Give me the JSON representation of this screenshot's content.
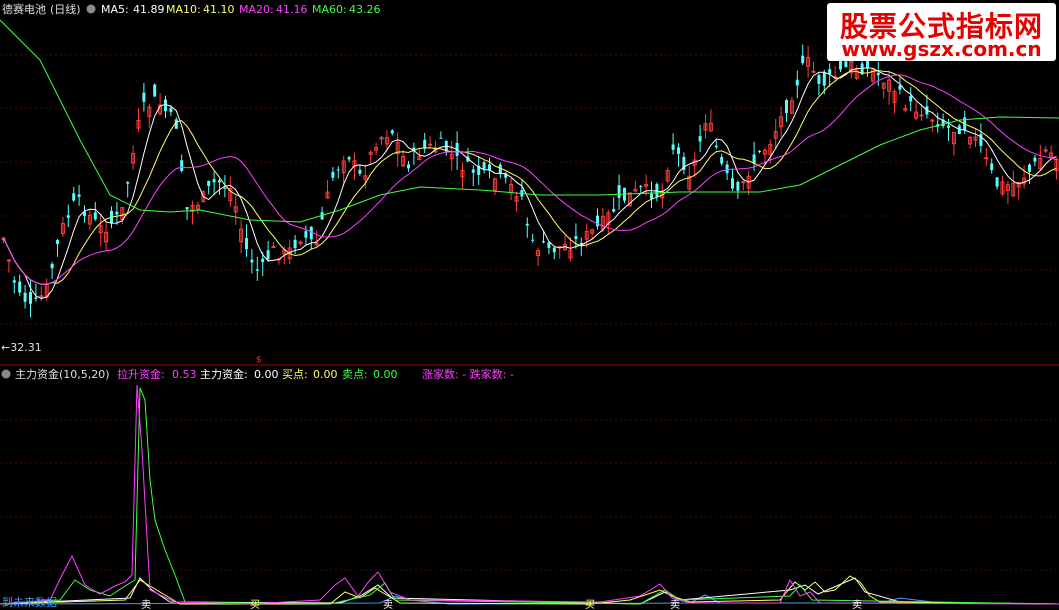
{
  "top_pane": {
    "stock_name": "德赛电池",
    "period": "(日线)",
    "ma": [
      {
        "label": "MA5:",
        "value": "41.89",
        "color": "#ffffff"
      },
      {
        "label": "MA10:",
        "value": "41.10",
        "color": "#ffff66"
      },
      {
        "label": "MA20:",
        "value": "41.16",
        "color": "#ff40ff"
      },
      {
        "label": "MA60:",
        "value": "43.26",
        "color": "#40ff40"
      }
    ],
    "low_marker": "←32.31"
  },
  "bottom_pane": {
    "indicator_name": "主力资金(10,5,20)",
    "fields": [
      {
        "label": "拉升资金:",
        "value": "0.53",
        "color": "#ff40ff"
      },
      {
        "label": "主力资金:",
        "value": "0.00",
        "color": "#ffffff"
      },
      {
        "label": "买点:",
        "value": "0.00",
        "color": "#ffff66"
      },
      {
        "label": "卖点:",
        "value": "0.00",
        "color": "#40ff40"
      }
    ],
    "rise_fall": {
      "label": "涨家数: - 跌家数: -",
      "color": "#ff40ff"
    },
    "footer_text": "到未来数据",
    "sell_marks": [
      "卖",
      "卖",
      "卖",
      "卖"
    ],
    "buy_marks": [
      "买",
      "买"
    ]
  },
  "watermark": {
    "title": "股票公式指标网",
    "url": "www.gszx.com.cn"
  },
  "colors": {
    "up_candle": "#ff3c3c",
    "down_candle": "#54ffff",
    "grid": "#7a0000",
    "separator": "#b00000"
  }
}
